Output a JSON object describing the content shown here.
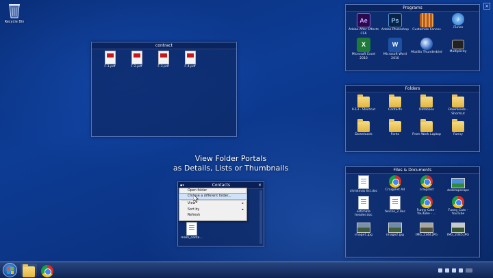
{
  "desktop": {
    "recycle_bin_label": "Recycle Bin"
  },
  "caption": {
    "line1": "View Folder Portals",
    "line2": "as Details, Lists or Thumbnails"
  },
  "portals": {
    "contract": {
      "title": "contract",
      "items": [
        "F-1.pdf",
        "F-2.pdf",
        "F-3.pdf",
        "F-4.pdf"
      ]
    },
    "programs": {
      "title": "Programs",
      "items": [
        {
          "label": "Adobe After Effects CS6",
          "icon": "after-effects-icon"
        },
        {
          "label": "Adobe Photoshop",
          "icon": "photoshop-icon"
        },
        {
          "label": "Customize Fences",
          "icon": "fences-icon"
        },
        {
          "label": "iTunes",
          "icon": "itunes-icon"
        },
        {
          "label": "Microsoft Excel 2010",
          "icon": "excel-icon"
        },
        {
          "label": "Microsoft Word 2010",
          "icon": "word-icon"
        },
        {
          "label": "Mozilla Thunderbird",
          "icon": "thunderbird-icon"
        },
        {
          "label": "Multiplicity",
          "icon": "multiplicity-icon"
        }
      ]
    },
    "folders": {
      "title": "Folders",
      "items": [
        "9-13 - Shortcut",
        "Contacts",
        "Database",
        "Downloads - Shortcut",
        "Downloads",
        "Fonts",
        "From Work Laptop",
        "Funny"
      ]
    },
    "files": {
      "title": "Files & Documents",
      "items": [
        {
          "label": "christmas list.doc",
          "icon": "document-icon"
        },
        {
          "label": "Craigslist Ad",
          "icon": "chrome-icon"
        },
        {
          "label": "craigslist",
          "icon": "chrome-icon"
        },
        {
          "label": "desktopscape",
          "icon": "image-icon"
        },
        {
          "label": "estimate header.doc",
          "icon": "document-icon"
        },
        {
          "label": "fences_2.doc",
          "icon": "document-icon"
        },
        {
          "label": "Funny Cats - YouTube - ...",
          "icon": "chrome-icon"
        },
        {
          "label": "Funny Cats - YouTube",
          "icon": "chrome-icon"
        },
        {
          "label": "image1.jpg",
          "icon": "photo-icon"
        },
        {
          "label": "image2.jpg",
          "icon": "photo-icon"
        },
        {
          "label": "IMG_2344.JPG",
          "icon": "photo-icon"
        },
        {
          "label": "IMG_2345.JPG",
          "icon": "photo-icon"
        }
      ]
    },
    "contacts": {
      "title": "Contacts",
      "file_label": "mark_conta...",
      "menu": {
        "items": [
          "Open folder",
          "Choose a different folder...",
          "View",
          "Sort by",
          "Refresh"
        ]
      }
    }
  },
  "colors": {
    "desktop_blue": "#0d3c95",
    "accent_red": "#c8161d"
  }
}
